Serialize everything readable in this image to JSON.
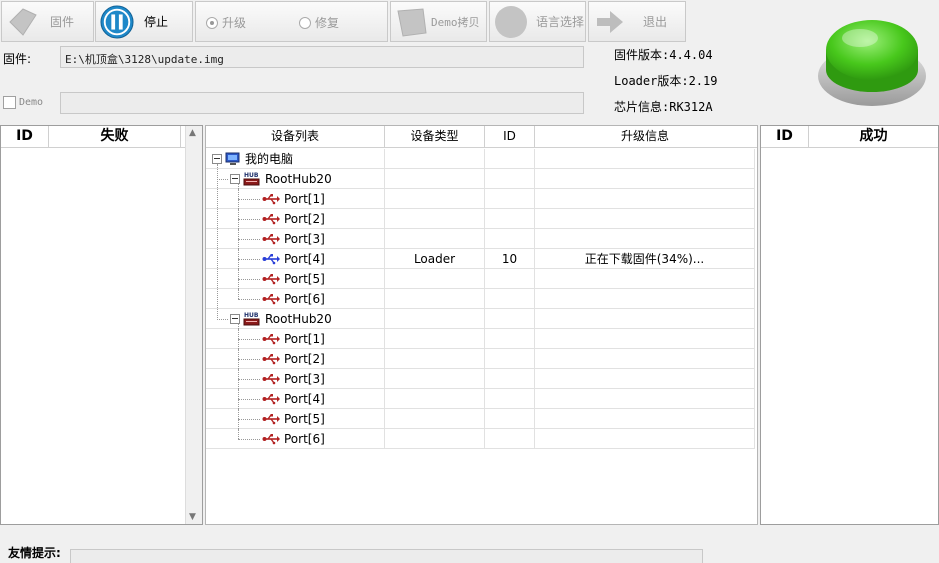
{
  "toolbar": {
    "firmware_label": "固件",
    "stop_label": "停止",
    "upgrade_label": "升级",
    "repair_label": "修复",
    "demo_copy_label": "Demo拷贝",
    "language_label": "语言选择",
    "exit_label": "退出"
  },
  "firmware": {
    "label": "固件:",
    "path": "E:\\机顶盒\\3128\\update.img"
  },
  "demo": {
    "label": "Demo",
    "checked": false
  },
  "info": {
    "fw_version": "固件版本:4.4.04",
    "loader_version": "Loader版本:2.19",
    "chip_info": "芯片信息:RK312A"
  },
  "fail_panel": {
    "col_id": "ID",
    "col_title": "失败"
  },
  "success_panel": {
    "col_id": "ID",
    "col_title": "成功"
  },
  "device_table": {
    "headers": [
      "设备列表",
      "设备类型",
      "ID",
      "升级信息"
    ],
    "rows": [
      {
        "name": "我的电脑",
        "level": 0,
        "icon": "computer-icon",
        "type": "",
        "id": "",
        "info": ""
      },
      {
        "name": "RootHub20",
        "level": 1,
        "icon": "usb-hub-icon",
        "type": "",
        "id": "",
        "info": ""
      },
      {
        "name": "Port[1]",
        "level": 2,
        "icon": "usb-port-icon",
        "type": "",
        "id": "",
        "info": ""
      },
      {
        "name": "Port[2]",
        "level": 2,
        "icon": "usb-port-icon",
        "type": "",
        "id": "",
        "info": ""
      },
      {
        "name": "Port[3]",
        "level": 2,
        "icon": "usb-port-icon",
        "type": "",
        "id": "",
        "info": ""
      },
      {
        "name": "Port[4]",
        "level": 2,
        "icon": "usb-port-active-icon",
        "type": "Loader",
        "id": "10",
        "info": "正在下载固件(34%)..."
      },
      {
        "name": "Port[5]",
        "level": 2,
        "icon": "usb-port-icon",
        "type": "",
        "id": "",
        "info": ""
      },
      {
        "name": "Port[6]",
        "level": 2,
        "icon": "usb-port-icon",
        "type": "",
        "id": "",
        "info": ""
      },
      {
        "name": "RootHub20",
        "level": 1,
        "icon": "usb-hub-icon",
        "type": "",
        "id": "",
        "info": ""
      },
      {
        "name": "Port[1]",
        "level": 2,
        "icon": "usb-port-icon",
        "type": "",
        "id": "",
        "info": ""
      },
      {
        "name": "Port[2]",
        "level": 2,
        "icon": "usb-port-icon",
        "type": "",
        "id": "",
        "info": ""
      },
      {
        "name": "Port[3]",
        "level": 2,
        "icon": "usb-port-icon",
        "type": "",
        "id": "",
        "info": ""
      },
      {
        "name": "Port[4]",
        "level": 2,
        "icon": "usb-port-icon",
        "type": "",
        "id": "",
        "info": ""
      },
      {
        "name": "Port[5]",
        "level": 2,
        "icon": "usb-port-icon",
        "type": "",
        "id": "",
        "info": ""
      },
      {
        "name": "Port[6]",
        "level": 2,
        "icon": "usb-port-icon",
        "type": "",
        "id": "",
        "info": ""
      }
    ]
  },
  "status_bar": {
    "tip_label": "友情提示:"
  },
  "colors": {
    "big_button": "#48c81c",
    "port_red": "#b22222",
    "port_active_blue": "#2a3fd8",
    "stop_blue": "#1e88c8"
  }
}
